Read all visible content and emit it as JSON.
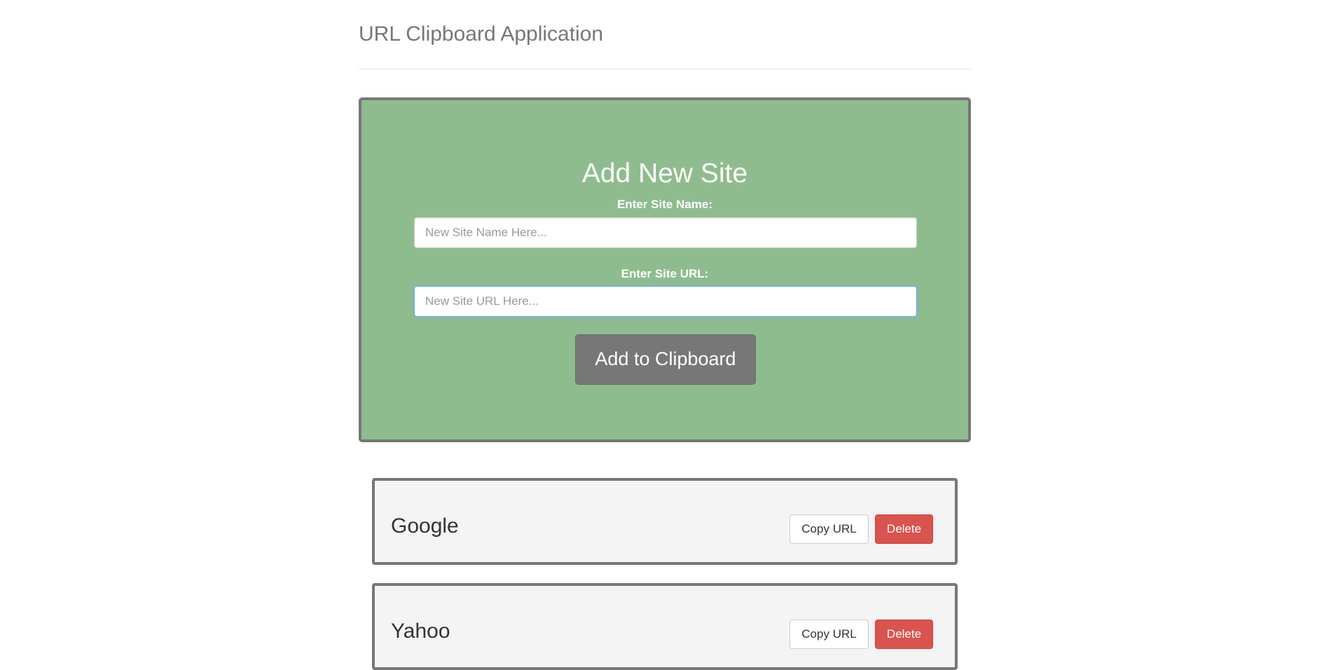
{
  "header": {
    "title": "URL Clipboard Application"
  },
  "add_site": {
    "title": "Add New Site",
    "name_label": "Enter Site Name:",
    "name_placeholder": "New Site Name Here...",
    "name_value": "",
    "url_label": "Enter Site URL:",
    "url_placeholder": "New Site URL Here...",
    "url_value": "",
    "submit_label": "Add to Clipboard"
  },
  "sites": [
    {
      "name": "Google",
      "copy_label": "Copy URL",
      "delete_label": "Delete"
    },
    {
      "name": "Yahoo",
      "copy_label": "Copy URL",
      "delete_label": "Delete"
    }
  ],
  "colors": {
    "panel_green": "#8fbc8f",
    "border_gray": "#777777",
    "card_background": "#f4f4f4",
    "delete_red": "#d9534f",
    "focus_blue": "#66afe9"
  }
}
